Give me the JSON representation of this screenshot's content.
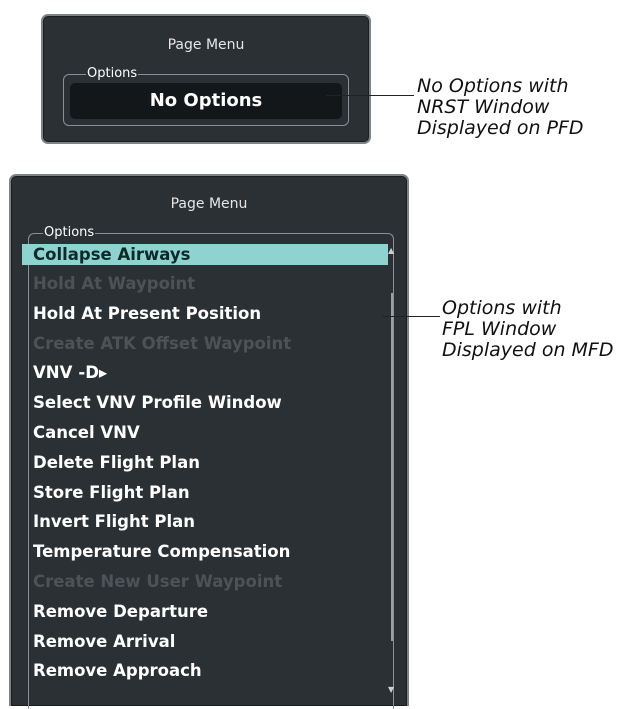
{
  "top_menu": {
    "title": "Page Menu",
    "options_label": "Options",
    "no_options": "No Options"
  },
  "bottom_menu": {
    "title": "Page Menu",
    "options_label": "Options",
    "items": [
      {
        "label": "Collapse Airways",
        "state": "selected"
      },
      {
        "label": "Hold At Waypoint",
        "state": "disabled"
      },
      {
        "label": "Hold At Present Position",
        "state": "enabled"
      },
      {
        "label": "Create ATK Offset Waypoint",
        "state": "disabled"
      },
      {
        "label": "VNV",
        "state": "enabled",
        "icon": "vnv-direct-icon",
        "icon_glyph": "-D▸"
      },
      {
        "label": "Select VNV Profile Window",
        "state": "enabled"
      },
      {
        "label": "Cancel VNV",
        "state": "enabled"
      },
      {
        "label": "Delete Flight Plan",
        "state": "enabled"
      },
      {
        "label": "Store Flight Plan",
        "state": "enabled"
      },
      {
        "label": "Invert Flight Plan",
        "state": "enabled"
      },
      {
        "label": "Temperature Compensation",
        "state": "enabled"
      },
      {
        "label": "Create New User Waypoint",
        "state": "disabled"
      },
      {
        "label": "Remove Departure",
        "state": "enabled"
      },
      {
        "label": "Remove Arrival",
        "state": "enabled"
      },
      {
        "label": "Remove Approach",
        "state": "enabled"
      }
    ]
  },
  "annotations": {
    "top": [
      "No Options with",
      "NRST Window",
      "Displayed on PFD"
    ],
    "bottom": [
      "Options with",
      "FPL Window",
      "Displayed on MFD"
    ]
  },
  "colors": {
    "panel_bg": "#2b3034",
    "highlight": "#8fd3d0",
    "disabled_text": "#4c5357"
  }
}
